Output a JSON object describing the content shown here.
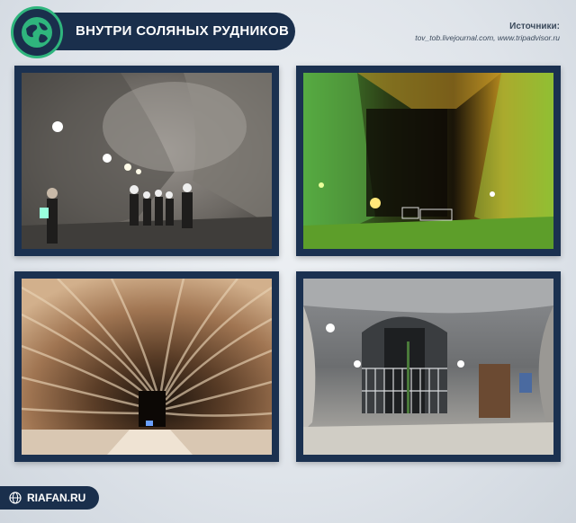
{
  "header": {
    "title": "ВНУТРИ СОЛЯНЫХ РУДНИКОВ",
    "sources_label": "Источники:",
    "sources_value": "tov_tob.livejournal.com, www.tripadvisor.ru"
  },
  "footer": {
    "site": "RIAFAN.RU"
  },
  "colors": {
    "navy": "#1a2f4c",
    "accent_green": "#2fb57d"
  },
  "icons": {
    "logo": "globe-logo-icon",
    "footer": "globe-icon"
  }
}
